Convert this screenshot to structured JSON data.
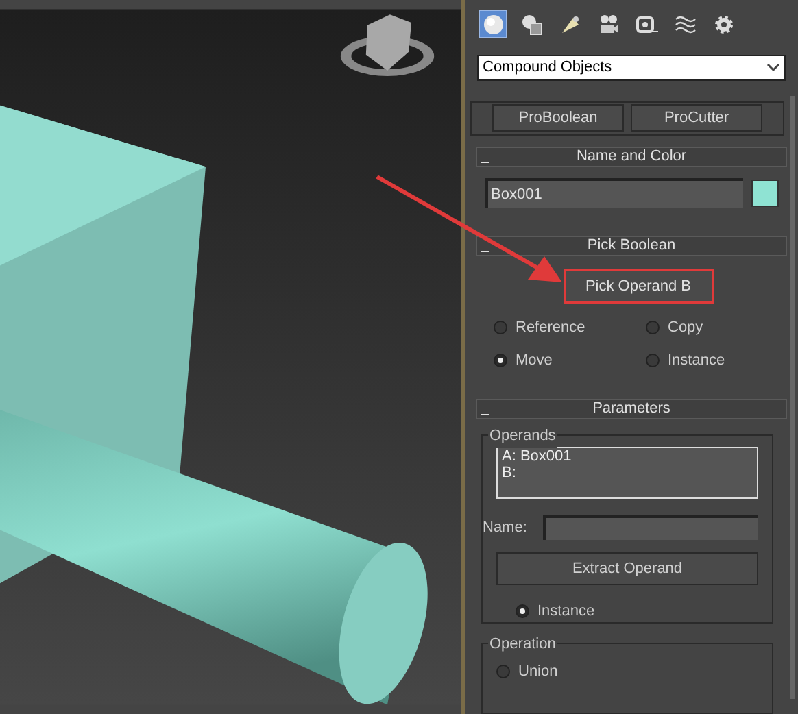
{
  "command_tabs": [
    {
      "kind": "sphere",
      "selected": true
    },
    {
      "kind": "shapes",
      "selected": false
    },
    {
      "kind": "lights",
      "selected": false
    },
    {
      "kind": "cameras",
      "selected": false
    },
    {
      "kind": "helpers",
      "selected": false
    },
    {
      "kind": "waves",
      "selected": false
    },
    {
      "kind": "systems",
      "selected": false
    }
  ],
  "category_dropdown": {
    "value": "Compound Objects"
  },
  "object_type_buttons": [
    "ProBoolean",
    "ProCutter"
  ],
  "name_and_color": {
    "title": "Name and Color",
    "name": "Box001",
    "color": "#8fe3d3"
  },
  "pick_boolean": {
    "title": "Pick Boolean",
    "button": "Pick Operand B",
    "highlighted": true,
    "options": [
      {
        "label": "Reference",
        "selected": false
      },
      {
        "label": "Copy",
        "selected": false
      },
      {
        "label": "Move",
        "selected": true
      },
      {
        "label": "Instance",
        "selected": false
      }
    ]
  },
  "parameters": {
    "title": "Parameters",
    "operands_label": "Operands",
    "operands": [
      "A: Box001",
      "B:"
    ],
    "name_label": "Name:",
    "extract_button": "Extract Operand",
    "extract_options": [
      {
        "label": "Instance",
        "selected": true
      }
    ],
    "operation_label": "Operation",
    "operations": [
      {
        "label": "Union",
        "selected": false
      }
    ]
  }
}
